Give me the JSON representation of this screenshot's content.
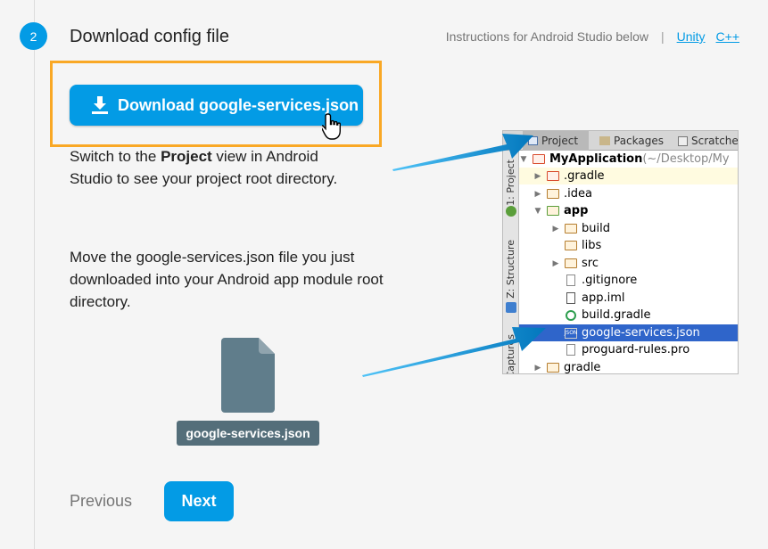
{
  "step": {
    "number": "2",
    "title": "Download config file"
  },
  "instructions": {
    "text": "Instructions for Android Studio below",
    "separator": "|",
    "links": [
      "Unity",
      "C++"
    ]
  },
  "download_button": {
    "label": "Download google-services.json"
  },
  "para1": {
    "before": "Switch to the ",
    "bold": "Project",
    "after": " view in Android Studio to see your project root directory."
  },
  "para2": {
    "text": "Move the google-services.json file you just downloaded into your Android app module root directory."
  },
  "file_tile": {
    "label": "google-services.json"
  },
  "nav": {
    "previous": "Previous",
    "next": "Next"
  },
  "ide": {
    "tabs": [
      "Project",
      "Packages",
      "Scratches"
    ],
    "side_labels": [
      "1: Project",
      "Z: Structure",
      "Captures"
    ],
    "root": {
      "name": "MyApplication",
      "path": " (~/Desktop/My"
    },
    "tree": [
      ".gradle",
      ".idea",
      "app",
      "build",
      "libs",
      "src",
      ".gitignore",
      "app.iml",
      "build.gradle",
      "google-services.json",
      "proguard-rules.pro",
      "gradle"
    ],
    "json_icon_text": "JSON"
  },
  "colors": {
    "accent": "#039be5",
    "highlight": "#f9a825",
    "tile": "#546e7a",
    "selection": "#2f65ca"
  }
}
